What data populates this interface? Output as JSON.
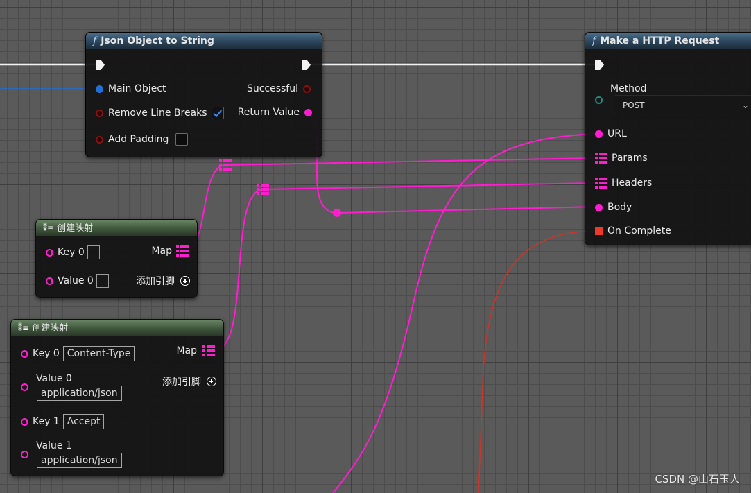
{
  "nodes": {
    "json_to_string": {
      "title": "Json Object to String",
      "inputs": {
        "main_object": "Main Object",
        "remove_line_breaks": "Remove Line Breaks",
        "add_padding": "Add Padding"
      },
      "outputs": {
        "successful": "Successful",
        "return_value": "Return Value"
      },
      "remove_line_breaks_checked": true,
      "add_padding_checked": false
    },
    "http_request": {
      "title": "Make a HTTP Request",
      "method_label": "Method",
      "method_value": "POST",
      "url": "URL",
      "params": "Params",
      "headers": "Headers",
      "body": "Body",
      "on_complete": "On Complete"
    },
    "make_map_1": {
      "title": "创建映射",
      "key0": "Key 0",
      "value0": "Value 0",
      "map": "Map",
      "add_pin": "添加引脚"
    },
    "make_map_2": {
      "title": "创建映射",
      "key0": "Key 0",
      "key0_value": "Content-Type",
      "value0": "Value 0",
      "value0_value": "application/json",
      "key1": "Key 1",
      "key1_value": "Accept",
      "value1": "Value 1",
      "value1_value": "application/json",
      "map": "Map",
      "add_pin": "添加引脚"
    }
  },
  "watermark": "CSDN @山石玉人",
  "colors": {
    "exec": "#f2f2f2",
    "object": "#1e6fd9",
    "boolean": "#8b1010",
    "string": "#ff1dd0",
    "delegate": "#ef3a2a",
    "enum": "#1f8f84",
    "graph_bg": "#5a5a5a"
  },
  "icons": [
    "function-icon",
    "make-map-icon",
    "exec-pin-icon",
    "map-pin-icon",
    "add-pin-icon",
    "checkmark-icon",
    "chevron-down-icon"
  ]
}
